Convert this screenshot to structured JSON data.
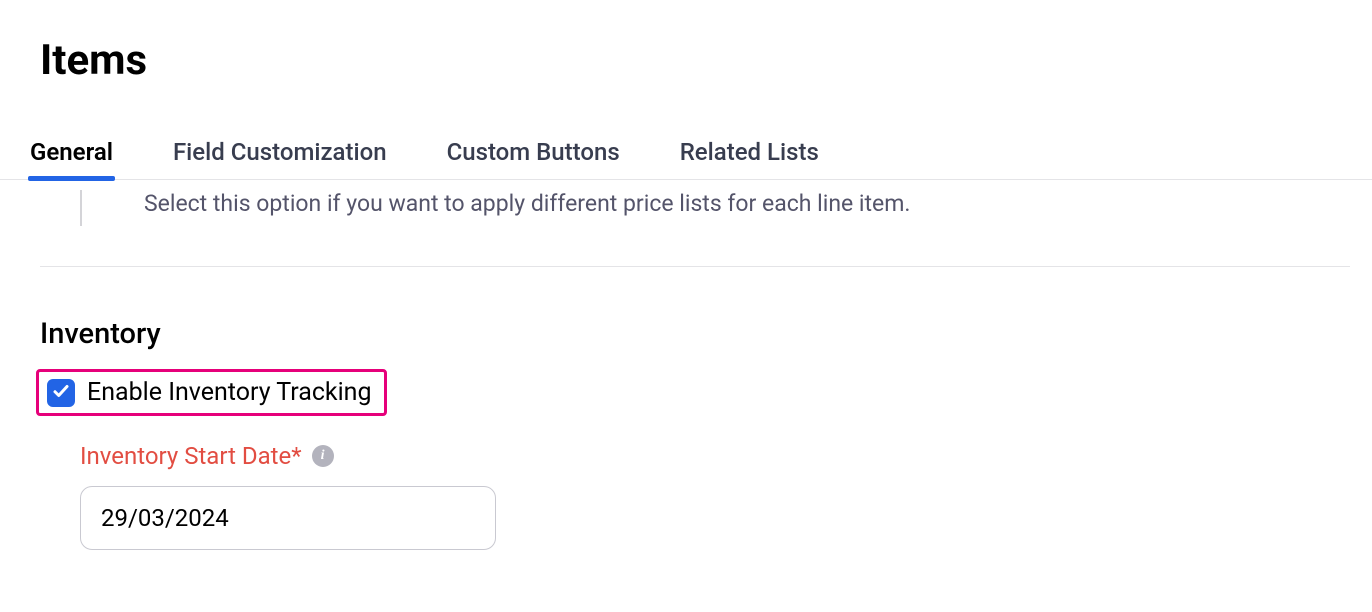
{
  "page": {
    "title": "Items"
  },
  "tabs": [
    {
      "label": "General",
      "active": true
    },
    {
      "label": "Field Customization",
      "active": false
    },
    {
      "label": "Custom Buttons",
      "active": false
    },
    {
      "label": "Related Lists",
      "active": false
    }
  ],
  "helper_text": "Select this option if you want to apply different price lists for each line item.",
  "inventory": {
    "heading": "Inventory",
    "enable_tracking_label": "Enable Inventory Tracking",
    "enable_tracking_checked": true,
    "start_date_label": "Inventory Start Date*",
    "start_date_value": "29/03/2024"
  }
}
